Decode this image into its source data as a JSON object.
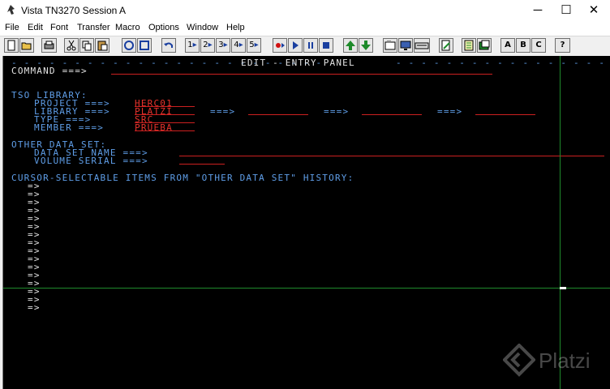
{
  "window": {
    "title": "Vista TN3270 Session A",
    "controls": [
      "─",
      "☐",
      "✕"
    ]
  },
  "menu": [
    "File",
    "Edit",
    "Font",
    "Transfer",
    "Macro",
    "Options",
    "Window",
    "Help"
  ],
  "toolbar": {
    "letters": [
      "A",
      "B",
      "C"
    ],
    "help": "?",
    "nums": [
      "1",
      "2",
      "3",
      "4",
      "5"
    ]
  },
  "panel": {
    "header_left": "- - - - - - - - - - - - - - - - - - - - - - - - -",
    "header_title": "EDIT - ENTRY PANEL",
    "header_right": "- - - - - - - - - - - - - - - - - - - - - - - - - - - -",
    "command_label": "COMMAND ===>",
    "tso_library": "TSO LIBRARY:",
    "project_label": "PROJECT ===>",
    "project_value": "HERC01",
    "library_label": "LIBRARY ===>",
    "library_value": "PLATZI",
    "type_label": "TYPE ===>",
    "type_value": "SRC",
    "member_label": "MEMBER ===>",
    "member_value": "PRUEBA",
    "arrow": "===>",
    "other_data_set": "OTHER DATA SET:",
    "data_set_name": "DATA SET NAME ===>",
    "volume_serial": "VOLUME SERIAL ===>",
    "history_header": "CURSOR-SELECTABLE ITEMS FROM \"OTHER DATA SET\" HISTORY:",
    "history_items": [
      "=>",
      "=>",
      "=>",
      "=>",
      "=>",
      "=>",
      "=>",
      "=>",
      "=>",
      "=>",
      "=>",
      "=>",
      "=>",
      "=>",
      "=>",
      "=>"
    ]
  },
  "watermark": "Platzi"
}
